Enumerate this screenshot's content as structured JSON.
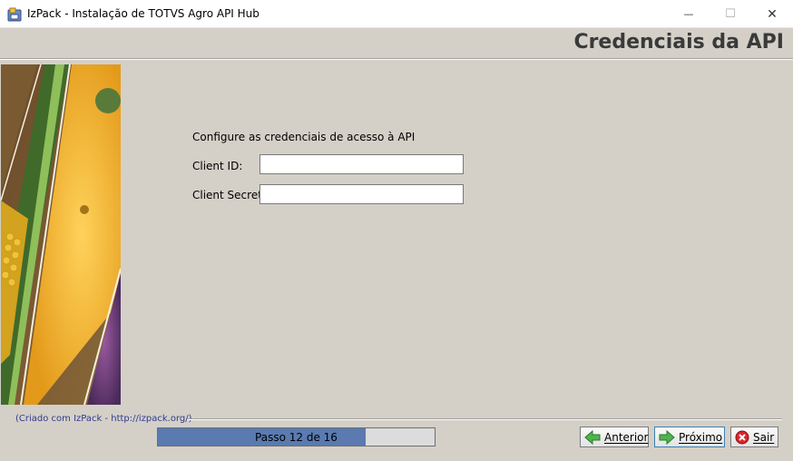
{
  "window": {
    "title": "IzPack - Instalação de TOTVS Agro API Hub",
    "controls": {
      "minimize": "—",
      "maximize": "☐",
      "close": "✕"
    }
  },
  "header": {
    "title": "Credenciais da API"
  },
  "form": {
    "intro": "Configure as credenciais de acesso à API",
    "fields": [
      {
        "label": "Client ID:",
        "value": ""
      },
      {
        "label": "Client Secret:",
        "value": ""
      }
    ]
  },
  "footer": {
    "credit": "(Criado com IzPack - http://izpack.org/)",
    "progress": {
      "text": "Passo 12 de 16",
      "current": 12,
      "total": 16
    },
    "buttons": {
      "previous": "Anterior",
      "next": "Próximo",
      "exit": "Sair"
    }
  },
  "colors": {
    "progress_fill": "#5a7ab0",
    "background": "#d4d0c8",
    "credit_text": "#2f3a8f"
  },
  "icons": {
    "previous": "arrow-left-icon",
    "next": "arrow-right-icon",
    "exit": "close-circle-icon"
  }
}
